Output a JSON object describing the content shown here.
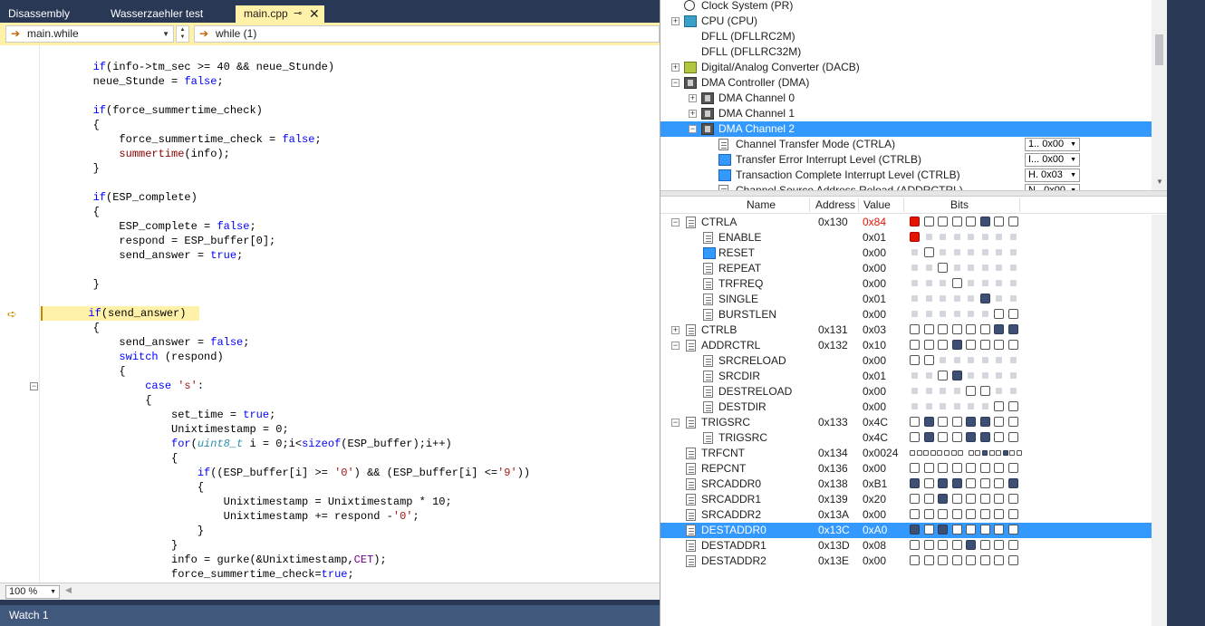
{
  "editor": {
    "tabs": [
      {
        "label": "Disassembly",
        "active": false
      },
      {
        "label": "Wasserzaehler test",
        "active": false
      },
      {
        "label": "main.cpp",
        "active": true
      }
    ],
    "tab_pin_icon": "pin-icon",
    "tab_close_icon": "close-icon",
    "nav_scope": "main.while",
    "nav_member": "while (1)",
    "zoom": "100 %",
    "watch_title": "Watch 1"
  },
  "code_lines": [
    {
      "indent": 8,
      "html": "if(info->tm_sec >= 40 && neue_Stunde)"
    },
    {
      "indent": 8,
      "html": "neue_Stunde = false;"
    },
    {
      "indent": 0,
      "html": ""
    },
    {
      "indent": 8,
      "html": "if(force_summertime_check)"
    },
    {
      "indent": 8,
      "html": "{"
    },
    {
      "indent": 12,
      "html": "force_summertime_check = false;"
    },
    {
      "indent": 12,
      "html": "summertime(info);"
    },
    {
      "indent": 8,
      "html": "}"
    },
    {
      "indent": 0,
      "html": ""
    },
    {
      "indent": 8,
      "html": "if(ESP_complete)"
    },
    {
      "indent": 8,
      "html": "{"
    },
    {
      "indent": 12,
      "html": "ESP_complete = false;"
    },
    {
      "indent": 12,
      "html": "respond = ESP_buffer[0];"
    },
    {
      "indent": 12,
      "html": "send_answer = true;"
    },
    {
      "indent": 0,
      "html": ""
    },
    {
      "indent": 8,
      "html": "}"
    },
    {
      "indent": 0,
      "html": ""
    },
    {
      "indent": 8,
      "html": "if(send_answer)"
    },
    {
      "indent": 8,
      "html": "{"
    },
    {
      "indent": 12,
      "html": "send_answer = false;"
    },
    {
      "indent": 12,
      "html": "switch (respond)"
    },
    {
      "indent": 12,
      "html": "{"
    },
    {
      "indent": 16,
      "html": "case 's':"
    },
    {
      "indent": 16,
      "html": "{"
    },
    {
      "indent": 20,
      "html": "set_time = true;"
    },
    {
      "indent": 20,
      "html": "Unixtimestamp = 0;"
    },
    {
      "indent": 20,
      "html": "for(uint8_t i = 0;i<sizeof(ESP_buffer);i++)"
    },
    {
      "indent": 20,
      "html": "{"
    },
    {
      "indent": 24,
      "html": "if((ESP_buffer[i] >= '0') && (ESP_buffer[i] <='9'))"
    },
    {
      "indent": 24,
      "html": "{"
    },
    {
      "indent": 28,
      "html": "Unixtimestamp = Unixtimestamp * 10;"
    },
    {
      "indent": 28,
      "html": "Unixtimestamp += respond -'0';"
    },
    {
      "indent": 24,
      "html": "}"
    },
    {
      "indent": 20,
      "html": "}"
    },
    {
      "indent": 20,
      "html": "info = gurke(&Unixtimestamp,CET);"
    },
    {
      "indent": 20,
      "html": "force_summertime_check=true;"
    }
  ],
  "tree_rows": [
    {
      "level": 0,
      "expander": "",
      "icon": "clock",
      "label": "Clock System (PR)"
    },
    {
      "level": 0,
      "expander": "+",
      "icon": "cpu",
      "label": "CPU (CPU)"
    },
    {
      "level": 0,
      "expander": "",
      "icon": "",
      "label": "DFLL (DFLLRC2M)"
    },
    {
      "level": 0,
      "expander": "",
      "icon": "",
      "label": "DFLL (DFLLRC32M)"
    },
    {
      "level": 0,
      "expander": "+",
      "icon": "adc",
      "label": "Digital/Analog Converter (DACB)"
    },
    {
      "level": 0,
      "expander": "−",
      "icon": "chip",
      "label": "DMA Controller (DMA)"
    },
    {
      "level": 1,
      "expander": "+",
      "icon": "chip",
      "label": "DMA Channel 0"
    },
    {
      "level": 1,
      "expander": "+",
      "icon": "chip",
      "label": "DMA Channel 1"
    },
    {
      "level": 1,
      "expander": "−",
      "icon": "chip",
      "label": "DMA Channel 2",
      "selected": true
    },
    {
      "level": 2,
      "expander": "",
      "icon": "reg",
      "label": "Channel Transfer Mode (CTRLA)",
      "combo": "1.. 0x00"
    },
    {
      "level": 2,
      "expander": "",
      "icon": "int",
      "label": "Transfer Error Interrupt Level (CTRLB)",
      "combo": "I... 0x00"
    },
    {
      "level": 2,
      "expander": "",
      "icon": "int",
      "label": "Transaction Complete Interrupt Level (CTRLB)",
      "combo": "H. 0x03"
    },
    {
      "level": 2,
      "expander": "",
      "icon": "reg",
      "label": "Channel Source Address Reload (ADDRCTRL)",
      "combo": "N.. 0x00"
    }
  ],
  "reg_header": {
    "name": "Name",
    "address": "Address",
    "value": "Value",
    "bits": "Bits"
  },
  "registers": [
    {
      "name": "CTRLA",
      "level": 0,
      "expander": "−",
      "address": "0x130",
      "value": "0x84",
      "red": true,
      "bits": "RbbbbDbb",
      "icon": "reg"
    },
    {
      "name": "ENABLE",
      "level": 1,
      "expander": "",
      "address": "",
      "value": "0x01",
      "bits": "R.......",
      "icon": "reg"
    },
    {
      "name": "RESET",
      "level": 1,
      "expander": "",
      "address": "",
      "value": "0x00",
      "bits": ".b......",
      "icon": "int"
    },
    {
      "name": "REPEAT",
      "level": 1,
      "expander": "",
      "address": "",
      "value": "0x00",
      "bits": "..b.....",
      "icon": "reg"
    },
    {
      "name": "TRFREQ",
      "level": 1,
      "expander": "",
      "address": "",
      "value": "0x00",
      "bits": "...b....",
      "icon": "reg"
    },
    {
      "name": "SINGLE",
      "level": 1,
      "expander": "",
      "address": "",
      "value": "0x01",
      "bits": ".....D..",
      "icon": "reg"
    },
    {
      "name": "BURSTLEN",
      "level": 1,
      "expander": "",
      "address": "",
      "value": "0x00",
      "bits": "......bb",
      "icon": "reg"
    },
    {
      "name": "CTRLB",
      "level": 0,
      "expander": "+",
      "address": "0x131",
      "value": "0x03",
      "bits": "bbbbbbDD",
      "icon": "reg"
    },
    {
      "name": "ADDRCTRL",
      "level": 0,
      "expander": "−",
      "address": "0x132",
      "value": "0x10",
      "bits": "bbbDbbbb",
      "icon": "reg"
    },
    {
      "name": "SRCRELOAD",
      "level": 1,
      "expander": "",
      "address": "",
      "value": "0x00",
      "bits": "bb......",
      "icon": "reg"
    },
    {
      "name": "SRCDIR",
      "level": 1,
      "expander": "",
      "address": "",
      "value": "0x01",
      "bits": "..bD....",
      "icon": "reg"
    },
    {
      "name": "DESTRELOAD",
      "level": 1,
      "expander": "",
      "address": "",
      "value": "0x00",
      "bits": "....bb..",
      "icon": "reg"
    },
    {
      "name": "DESTDIR",
      "level": 1,
      "expander": "",
      "address": "",
      "value": "0x00",
      "bits": "......bb",
      "icon": "reg"
    },
    {
      "name": "TRIGSRC",
      "level": 0,
      "expander": "−",
      "address": "0x133",
      "value": "0x4C",
      "bits": "bDbbDDbb",
      "icon": "reg"
    },
    {
      "name": "TRIGSRC",
      "level": 1,
      "expander": "",
      "address": "",
      "value": "0x4C",
      "bits": "bDbbDDbb",
      "icon": "reg"
    },
    {
      "name": "TRFCNT",
      "level": 0,
      "expander": "",
      "address": "0x134",
      "value": "0x0024",
      "bits": "16",
      "icon": "reg"
    },
    {
      "name": "REPCNT",
      "level": 0,
      "expander": "",
      "address": "0x136",
      "value": "0x00",
      "bits": "bbbbbbbb",
      "icon": "reg"
    },
    {
      "name": "SRCADDR0",
      "level": 0,
      "expander": "",
      "address": "0x138",
      "value": "0xB1",
      "bits": "DbDDbbbD",
      "icon": "reg"
    },
    {
      "name": "SRCADDR1",
      "level": 0,
      "expander": "",
      "address": "0x139",
      "value": "0x20",
      "bits": "bbDbbbbb",
      "icon": "reg"
    },
    {
      "name": "SRCADDR2",
      "level": 0,
      "expander": "",
      "address": "0x13A",
      "value": "0x00",
      "bits": "bbbbbbbb",
      "icon": "reg"
    },
    {
      "name": "DESTADDR0",
      "level": 0,
      "expander": "",
      "address": "0x13C",
      "value": "0xA0",
      "bits": "DbDbbbbb",
      "icon": "reg",
      "selected": true
    },
    {
      "name": "DESTADDR1",
      "level": 0,
      "expander": "",
      "address": "0x13D",
      "value": "0x08",
      "bits": "bbbbDbbb",
      "icon": "reg"
    },
    {
      "name": "DESTADDR2",
      "level": 0,
      "expander": "",
      "address": "0x13E",
      "value": "0x00",
      "bits": "bbbbbbbb",
      "icon": "reg"
    }
  ],
  "trfcnt_bits": "bbbbbbbbbbDbbDbb",
  "colors": {
    "accent": "#3399ff",
    "highlight": "#fff1a8",
    "bit_on": "#3d4f73",
    "bit_red": "#e51400",
    "chrome": "#293955"
  }
}
